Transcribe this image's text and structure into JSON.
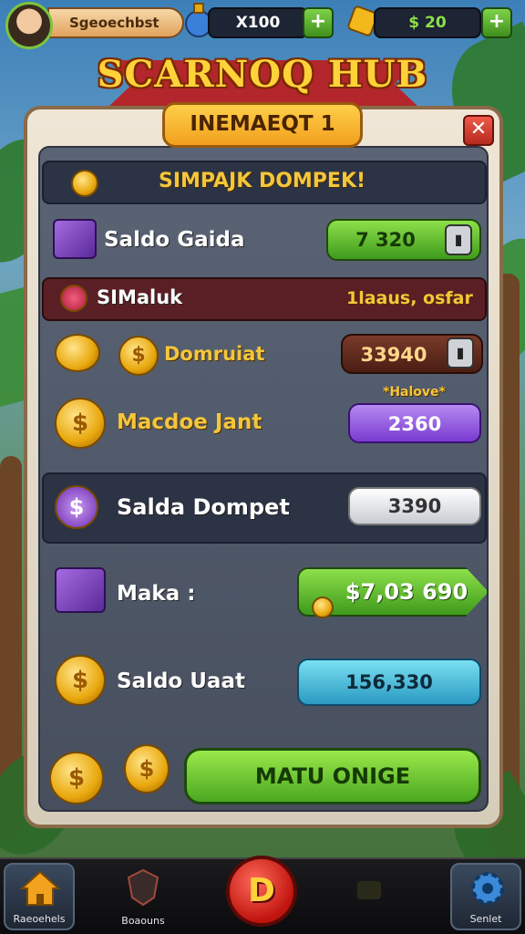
{
  "header": {
    "player_name": "Sgeoechbst",
    "resource1_value": "X100",
    "resource1_plus": "+",
    "resource2_value": "$ 20",
    "resource2_plus": "+"
  },
  "title": "SCARNOQ HUB",
  "panel": {
    "subheader": "INEMAEQT 1",
    "close_label": "✕",
    "banner_text": "SIMPAJK DOMPEK!",
    "rows": [
      {
        "label": "Saldo Gaida",
        "value": "7 320",
        "lock": "▮"
      },
      {
        "label": "SIMaluk",
        "value": "1laaus, osfar"
      },
      {
        "label": "Domruiat",
        "value": "33940",
        "lock": "▮"
      },
      {
        "label": "Macdoe Jant",
        "tag": "*Halove*",
        "value": "2360"
      },
      {
        "label": "Salda Dompet",
        "value": "3390"
      },
      {
        "label": "Maka :",
        "value": "$7,03 690"
      },
      {
        "label": "Saldo Uaat",
        "value": "156,330"
      }
    ],
    "action_button": "MATU ONIGE"
  },
  "nav": {
    "items": [
      "Raeoehels",
      "Boaouns",
      "",
      "",
      "Senlet"
    ],
    "center_badge": "D"
  },
  "colors": {
    "green": "#5dbf2a",
    "maroon": "#5a1f24",
    "purple": "#8d55e0",
    "teal": "#3bb7d6",
    "gold": "#f4c63a"
  }
}
